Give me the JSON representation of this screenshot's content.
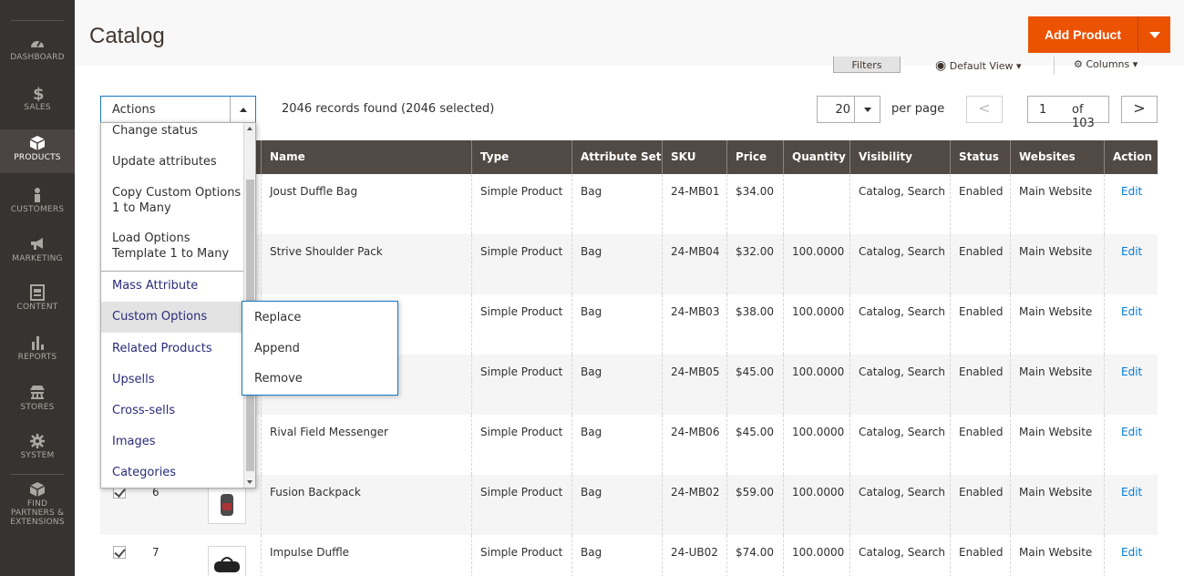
{
  "nav": {
    "items": [
      {
        "label": "DASHBOARD",
        "icon": "dashboard-icon"
      },
      {
        "label": "SALES",
        "icon": "dollar-icon"
      },
      {
        "label": "PRODUCTS",
        "icon": "cube-icon"
      },
      {
        "label": "CUSTOMERS",
        "icon": "person-icon"
      },
      {
        "label": "MARKETING",
        "icon": "megaphone-icon"
      },
      {
        "label": "CONTENT",
        "icon": "layout-icon"
      },
      {
        "label": "REPORTS",
        "icon": "bar-chart-icon"
      },
      {
        "label": "STORES",
        "icon": "store-icon"
      },
      {
        "label": "SYSTEM",
        "icon": "gear-icon"
      }
    ],
    "partners_line1": "FIND",
    "partners_line2": "PARTNERS &",
    "partners_line3": "EXTENSIONS"
  },
  "header": {
    "title": "Catalog",
    "add_label": "Add Product",
    "filters": "Filters",
    "default_view": "Default View",
    "columns": "Columns"
  },
  "toolbar": {
    "actions_label": "Actions",
    "records": "2046 records found (2046 selected)",
    "per_page_value": "20",
    "per_page_label": "per page",
    "prev": "<",
    "page": "1",
    "of": "of 103",
    "next": ">"
  },
  "grid": {
    "headers": [
      "Name",
      "Type",
      "Attribute Set",
      "SKU",
      "Price",
      "Quantity",
      "Visibility",
      "Status",
      "Websites",
      "Action"
    ],
    "rows": [
      {
        "id": "",
        "name": "Joust Duffle Bag",
        "type": "Simple Product",
        "set": "Bag",
        "sku": "24-MB01",
        "price": "$34.00",
        "qty": "",
        "vis": "Catalog, Search",
        "status": "Enabled",
        "web": "Main Website",
        "action": "Edit"
      },
      {
        "id": "",
        "name": "Strive Shoulder Pack",
        "type": "Simple Product",
        "set": "Bag",
        "sku": "24-MB04",
        "price": "$32.00",
        "qty": "100.0000",
        "vis": "Catalog, Search",
        "status": "Enabled",
        "web": "Main Website",
        "action": "Edit"
      },
      {
        "id": "",
        "name": "",
        "type": "Simple Product",
        "set": "Bag",
        "sku": "24-MB03",
        "price": "$38.00",
        "qty": "100.0000",
        "vis": "Catalog, Search",
        "status": "Enabled",
        "web": "Main Website",
        "action": "Edit"
      },
      {
        "id": "",
        "name": "",
        "type": "Simple Product",
        "set": "Bag",
        "sku": "24-MB05",
        "price": "$45.00",
        "qty": "100.0000",
        "vis": "Catalog, Search",
        "status": "Enabled",
        "web": "Main Website",
        "action": "Edit"
      },
      {
        "id": "",
        "name": "Rival Field Messenger",
        "type": "Simple Product",
        "set": "Bag",
        "sku": "24-MB06",
        "price": "$45.00",
        "qty": "100.0000",
        "vis": "Catalog, Search",
        "status": "Enabled",
        "web": "Main Website",
        "action": "Edit"
      },
      {
        "id": "6",
        "name": "Fusion Backpack",
        "type": "Simple Product",
        "set": "Bag",
        "sku": "24-MB02",
        "price": "$59.00",
        "qty": "100.0000",
        "vis": "Catalog, Search",
        "status": "Enabled",
        "web": "Main Website",
        "action": "Edit"
      },
      {
        "id": "7",
        "name": "Impulse Duffle",
        "type": "Simple Product",
        "set": "Bag",
        "sku": "24-UB02",
        "price": "$74.00",
        "qty": "100.0000",
        "vis": "Catalog, Search",
        "status": "Enabled",
        "web": "Main Website",
        "action": "Edit"
      }
    ]
  },
  "actions_menu": {
    "items": [
      "Change status",
      "Update attributes",
      "Copy Custom Options",
      "1 to Many",
      "Load Options",
      "Template 1 to Many",
      "Mass Attribute",
      "Custom Options",
      "Related Products",
      "Upsells",
      "Cross-sells",
      "Images",
      "Categories"
    ],
    "submenu": [
      "Replace",
      "Append",
      "Remove"
    ]
  }
}
